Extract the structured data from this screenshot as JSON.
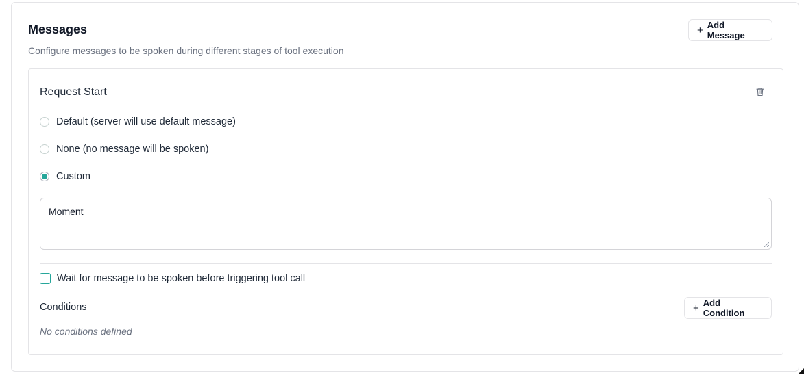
{
  "section": {
    "title": "Messages",
    "subtitle": "Configure messages to be spoken during different stages of tool execution",
    "add_message_label": "Add Message"
  },
  "message_card": {
    "title": "Request Start",
    "delete_icon": "trash-icon",
    "options": [
      {
        "label": "Default (server will use default message)",
        "selected": false
      },
      {
        "label": "None (no message will be spoken)",
        "selected": false
      },
      {
        "label": "Custom",
        "selected": true
      }
    ],
    "custom_message_value": "Moment",
    "wait_checkbox": {
      "label": "Wait for message to be spoken before triggering tool call",
      "checked": false
    },
    "conditions": {
      "label": "Conditions",
      "add_condition_label": "Add Condition",
      "empty_text": "No conditions defined"
    }
  },
  "colors": {
    "accent": "#26a69a",
    "border": "#e4e4e7",
    "muted_text": "#6b7280"
  }
}
